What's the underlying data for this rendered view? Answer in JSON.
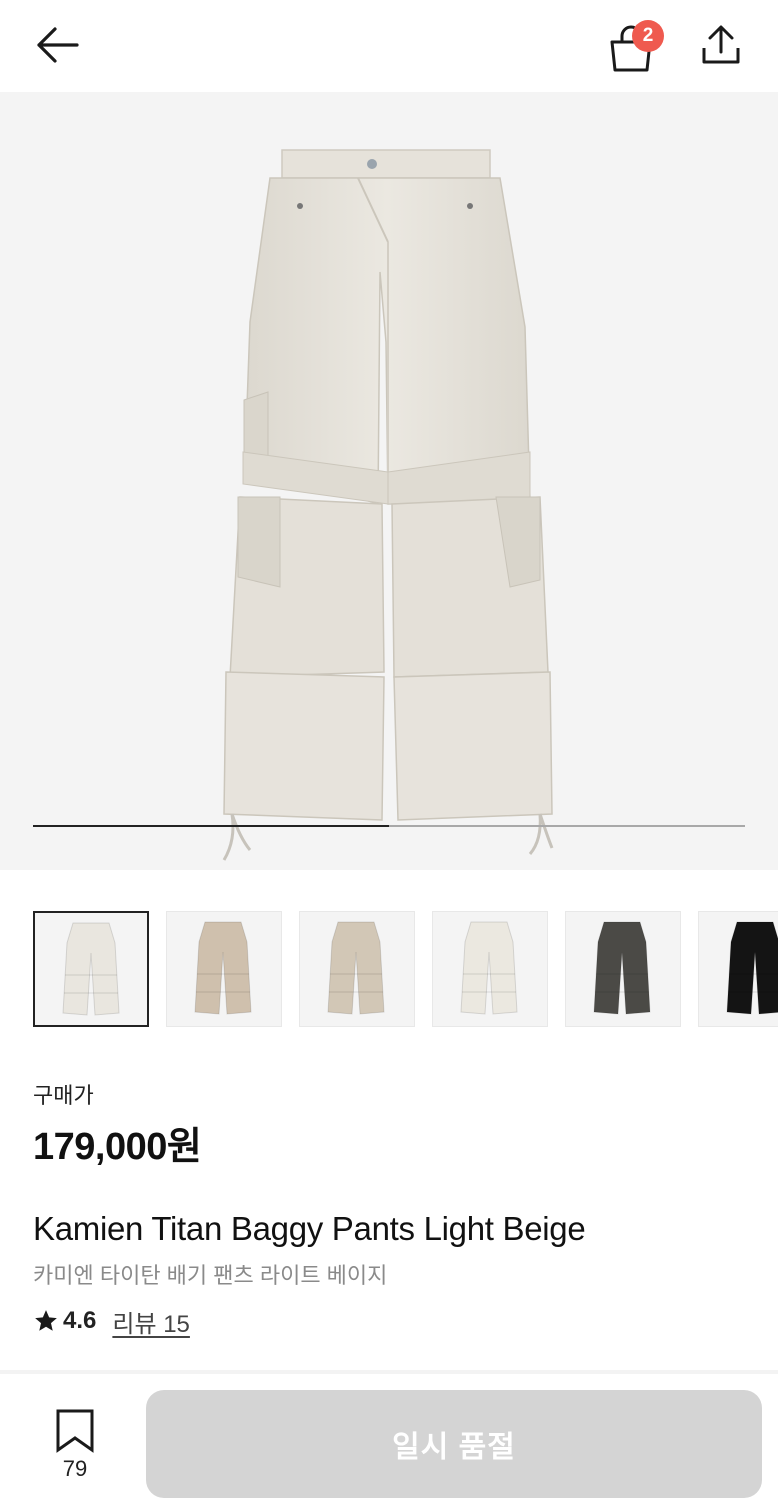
{
  "header": {
    "back_icon": "arrow-left-icon",
    "cart_icon": "shopping-bag-icon",
    "cart_count": "2",
    "share_icon": "share-upload-icon"
  },
  "gallery": {
    "image_description": "pants-main-image",
    "slide_progress": 0.5,
    "thumbnails": [
      {
        "color": "#e9e6df",
        "selected": true
      },
      {
        "color": "#cfc0ad",
        "selected": false
      },
      {
        "color": "#d2c7b6",
        "selected": false
      },
      {
        "color": "#ebe8e0",
        "selected": false
      },
      {
        "color": "#4b4a46",
        "selected": false
      },
      {
        "color": "#141414",
        "selected": false
      }
    ]
  },
  "price": {
    "label": "구매가",
    "value": "179,000원"
  },
  "product": {
    "name_en": "Kamien Titan Baggy Pants Light Beige",
    "name_ko": "카미엔 타이탄 배기 팬츠 라이트 베이지",
    "rating": "4.6",
    "review_link": "리뷰 15"
  },
  "bottom": {
    "bookmark_icon": "bookmark-icon",
    "bookmark_count": "79",
    "soldout_label": "일시 품절"
  },
  "colors": {
    "badge": "#ef5a4f",
    "pants": "#e7e3dc",
    "disabled_button": "#d4d4d4"
  }
}
